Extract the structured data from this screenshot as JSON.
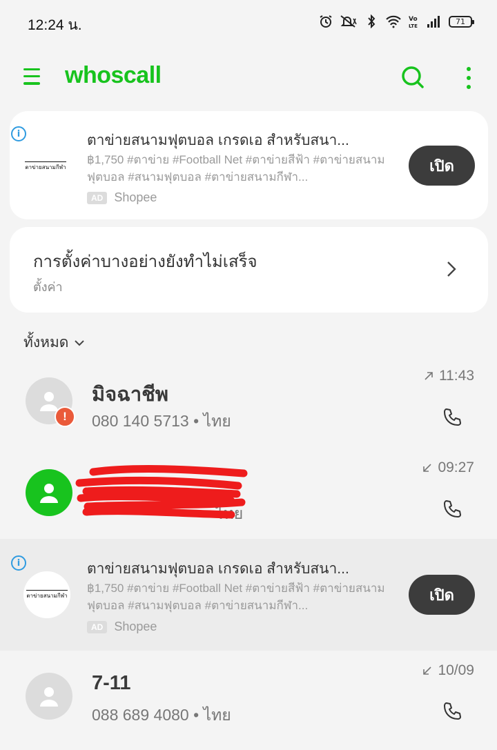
{
  "status_bar": {
    "time": "12:24 น.",
    "battery": "71",
    "icons": [
      "alarm-icon",
      "mute-icon",
      "bluetooth-icon",
      "wifi-icon",
      "volte-icon",
      "signal-icon",
      "battery-icon"
    ]
  },
  "header": {
    "brand": "whoscall",
    "brand_color": "#18c31e"
  },
  "ad_top": {
    "title": "ตาข่ายสนามฟุตบอล เกรดเอ สำหรับสนา...",
    "description": "฿1,750 #ตาข่าย #Football Net #ตาข่ายสีฟ้า #ตาข่ายสนาม ฟุตบอล #สนามฟุตบอล #ตาข่ายสนามกีฬา...",
    "ad_tag": "AD",
    "source": "Shopee",
    "button": "เปิด",
    "thumb_text": "ตาข่ายสนามกีฬา"
  },
  "settings_notice": {
    "title": "การตั้งค่าบางอย่างยังทำไม่เสร็จ",
    "subtitle": "ตั้งค่า"
  },
  "filter": {
    "label": "ทั้งหมด"
  },
  "calls": [
    {
      "name": "มิจฉาชีพ",
      "number": "080 140 5713 • ไทย",
      "time": "11:43",
      "direction": "outgoing",
      "avatar": "gray",
      "warning": "!"
    },
    {
      "name": "",
      "number": "ไทย",
      "time": "09:27",
      "direction": "incoming",
      "avatar": "green",
      "redacted": true
    },
    {
      "name": "7-11",
      "number": "088 689 4080 • ไทย",
      "time": "10/09",
      "direction": "incoming",
      "avatar": "gray"
    }
  ],
  "ad_inline": {
    "title": "ตาข่ายสนามฟุตบอล เกรดเอ สำหรับสนา...",
    "description": "฿1,750 #ตาข่าย #Football Net #ตาข่ายสีฟ้า #ตาข่ายสนาม ฟุตบอล #สนามฟุตบอล #ตาข่ายสนามกีฬา...",
    "ad_tag": "AD",
    "source": "Shopee",
    "button": "เปิด",
    "thumb_text": "ตาข่ายสนามกีฬา"
  },
  "colors": {
    "accent": "#18c31e",
    "warning": "#ea5a3a",
    "info": "#2f9be0",
    "button_dark": "#3c3c3c"
  }
}
